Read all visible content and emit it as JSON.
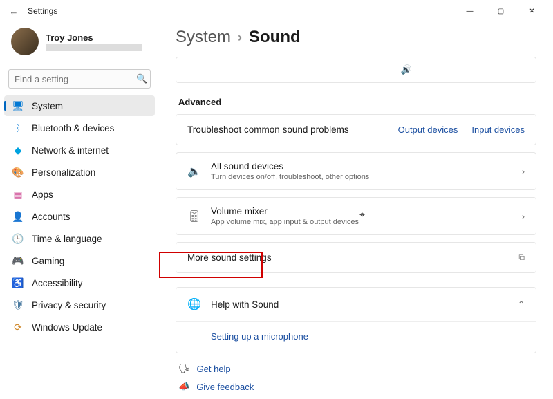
{
  "titlebar": {
    "title": "Settings"
  },
  "user": {
    "name": "Troy Jones"
  },
  "search": {
    "placeholder": "Find a setting"
  },
  "nav": [
    {
      "label": "System",
      "icon": "🖥",
      "color": "#0078d4",
      "active": true,
      "name": "system"
    },
    {
      "label": "Bluetooth & devices",
      "icon": "ᛒ",
      "color": "#0078d4",
      "name": "bluetooth"
    },
    {
      "label": "Network & internet",
      "icon": "◆",
      "color": "#00a3e0",
      "name": "network"
    },
    {
      "label": "Personalization",
      "icon": "🎨",
      "color": "#444",
      "name": "personalization"
    },
    {
      "label": "Apps",
      "icon": "▦",
      "color": "#d35c9e",
      "name": "apps"
    },
    {
      "label": "Accounts",
      "icon": "👤",
      "color": "#5a7a9e",
      "name": "accounts"
    },
    {
      "label": "Time & language",
      "icon": "🕒",
      "color": "#5a7a9e",
      "name": "time-language"
    },
    {
      "label": "Gaming",
      "icon": "🎮",
      "color": "#666",
      "name": "gaming"
    },
    {
      "label": "Accessibility",
      "icon": "♿",
      "color": "#4a7aa0",
      "name": "accessibility"
    },
    {
      "label": "Privacy & security",
      "icon": "🛡",
      "color": "#4a7aa0",
      "name": "privacy"
    },
    {
      "label": "Windows Update",
      "icon": "⟳",
      "color": "#d08a2e",
      "name": "update"
    }
  ],
  "breadcrumb": {
    "parent": "System",
    "current": "Sound"
  },
  "advanced_label": "Advanced",
  "troubleshoot": {
    "title": "Troubleshoot common sound problems",
    "output": "Output devices",
    "input": "Input devices"
  },
  "rows": {
    "all_sound": {
      "title": "All sound devices",
      "sub": "Turn devices on/off, troubleshoot, other options"
    },
    "mixer": {
      "title": "Volume mixer",
      "sub": "App volume mix, app input & output devices"
    }
  },
  "more_sound": "More sound settings",
  "help": {
    "title": "Help with Sound",
    "item": "Setting up a microphone"
  },
  "footer": {
    "get_help": "Get help",
    "feedback": "Give feedback"
  }
}
